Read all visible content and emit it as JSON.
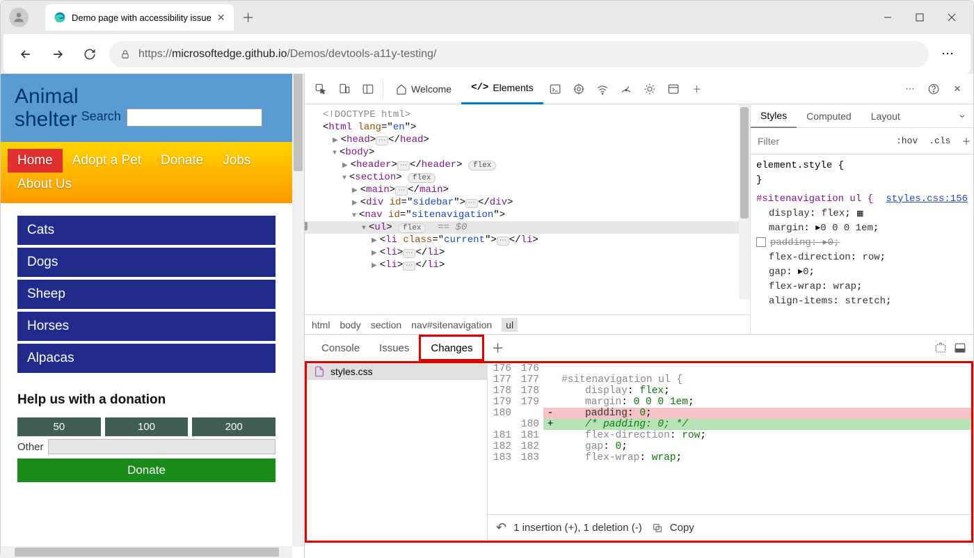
{
  "browser": {
    "tab_title": "Demo page with accessibility issue",
    "url_gray_prefix": "https://",
    "url_host": "microsoftedge.github.io",
    "url_path": "/Demos/devtools-a11y-testing/"
  },
  "page": {
    "site_title_l1": "Animal",
    "site_title_l2": "shelter",
    "search_label": "Search",
    "nav": [
      "Home",
      "Adopt a Pet",
      "Donate",
      "Jobs",
      "About Us"
    ],
    "nav_current_index": 0,
    "categories": [
      "Cats",
      "Dogs",
      "Sheep",
      "Horses",
      "Alpacas"
    ],
    "donation_heading": "Help us with a donation",
    "donation_amounts": [
      "50",
      "100",
      "200"
    ],
    "other_label": "Other",
    "donate_button": "Donate"
  },
  "devtools": {
    "tabs": {
      "welcome": "Welcome",
      "elements": "Elements"
    },
    "dom": {
      "doctype": "<!DOCTYPE html>",
      "html_open": "html",
      "lang": "en",
      "head": "head",
      "body": "body",
      "header": "header",
      "flex_pill": "flex",
      "section": "section",
      "main": "main",
      "div": "div",
      "id_sidebar": "sidebar",
      "nav": "nav",
      "id_sitenav": "sitenavigation",
      "ul": "ul",
      "eq0": "== $0",
      "li": "li",
      "class_current": "current"
    },
    "breadcrumb": [
      "html",
      "body",
      "section",
      "nav#sitenavigation",
      "ul"
    ],
    "styles": {
      "tabs": [
        "Styles",
        "Computed",
        "Layout"
      ],
      "filter_placeholder": "Filter",
      "hov": ":hov",
      "cls": ".cls",
      "element_style": "element.style {",
      "selector": "#sitenavigation ul {",
      "source_link": "styles.css:156",
      "props": {
        "display": "display",
        "display_v": "flex",
        "margin": "margin",
        "margin_v": "0 0 0 1em",
        "padding": "padding",
        "padding_v": "0",
        "flex_direction": "flex-direction",
        "flex_direction_v": "row",
        "gap": "gap",
        "gap_v": "0",
        "flex_wrap": "flex-wrap",
        "flex_wrap_v": "wrap",
        "align_items": "align-items",
        "align_items_v": "stretch"
      }
    },
    "drawer": {
      "tabs": [
        "Console",
        "Issues",
        "Changes"
      ],
      "file": "styles.css",
      "diff": {
        "lines": [
          {
            "old": "176",
            "new": "176",
            "code": ""
          },
          {
            "old": "177",
            "new": "177",
            "code": "#sitenavigation ul {"
          },
          {
            "old": "178",
            "new": "178",
            "code": "display: flex;"
          },
          {
            "old": "179",
            "new": "179",
            "code": "margin: 0 0 0 1em;"
          },
          {
            "old": "180",
            "new": "",
            "type": "rem",
            "code": "padding: 0;"
          },
          {
            "old": "",
            "new": "180",
            "type": "add",
            "code": "/* padding: 0; */"
          },
          {
            "old": "181",
            "new": "181",
            "code": "flex-direction: row;"
          },
          {
            "old": "182",
            "new": "182",
            "code": "gap: 0;"
          },
          {
            "old": "183",
            "new": "183",
            "code": "flex-wrap: wrap;"
          }
        ]
      },
      "status": "1 insertion (+), 1 deletion (-)",
      "copy": "Copy"
    }
  }
}
